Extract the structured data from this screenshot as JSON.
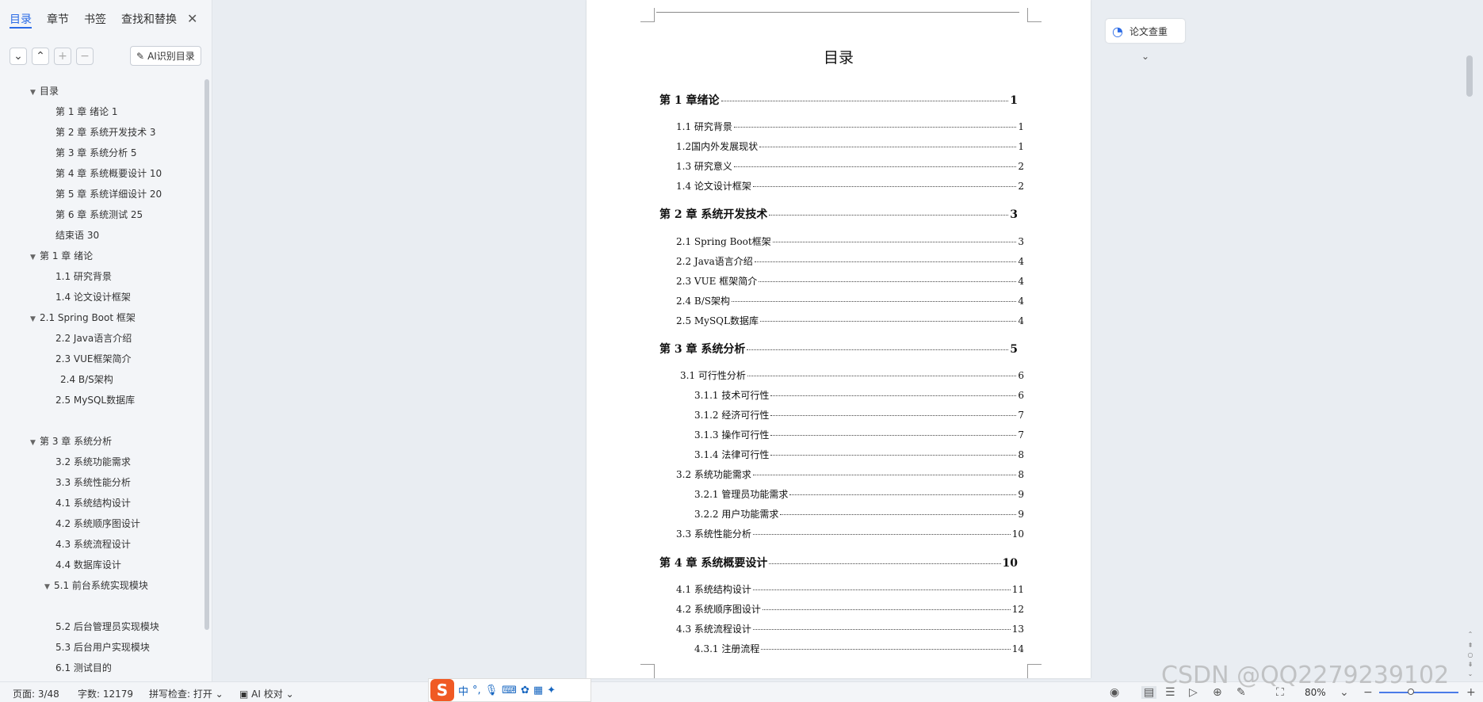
{
  "left_panel": {
    "tabs": [
      "目录",
      "章节",
      "书签",
      "查找和替换"
    ],
    "ai_button": "AI识别目录",
    "tree": [
      {
        "text": "目录",
        "level": 0,
        "expanded": true
      },
      {
        "text": "第 1 章  绪论 1",
        "level": 1
      },
      {
        "text": "第 2 章  系统开发技术 3",
        "level": 1
      },
      {
        "text": "第 3 章  系统分析 5",
        "level": 1
      },
      {
        "text": "第 4 章  系统概要设计 10",
        "level": 1
      },
      {
        "text": "第 5 章  系统详细设计 20",
        "level": 1
      },
      {
        "text": "第 6 章  系统测试 25",
        "level": 1
      },
      {
        "text": "结束语 30",
        "level": 1
      },
      {
        "text": "第 1 章  绪论",
        "level": 0,
        "expanded": true
      },
      {
        "text": "1.1  研究背景",
        "level": 1
      },
      {
        "text": "1.4  论文设计框架",
        "level": 1
      },
      {
        "text": "2.1 Spring Boot 框架",
        "level": 0,
        "expanded": true
      },
      {
        "text": "2.2 Java语言介绍",
        "level": 1
      },
      {
        "text": "2.3 VUE框架简介",
        "level": 1
      },
      {
        "text": "2.4    B/S架构",
        "level": 1
      },
      {
        "text": "2.5 MySQL数据库",
        "level": 1
      },
      {
        "text": "",
        "level": 1
      },
      {
        "text": "第 3 章  系统分析",
        "level": 0,
        "expanded": true
      },
      {
        "text": "3.2  系统功能需求",
        "level": 1
      },
      {
        "text": "3.3  系统性能分析",
        "level": 1
      },
      {
        "text": "4.1  系统结构设计",
        "level": 1
      },
      {
        "text": "4.2  系统顺序图设计",
        "level": 1
      },
      {
        "text": "4.3  系统流程设计",
        "level": 1
      },
      {
        "text": "4.4  数据库设计",
        "level": 1
      },
      {
        "text": "5.1  前台系统实现模块",
        "level": 1,
        "expanded": true
      },
      {
        "text": "",
        "level": 1
      },
      {
        "text": "5.2  后台管理员实现模块",
        "level": 1
      },
      {
        "text": "5.3  后台用户实现模块",
        "level": 1
      },
      {
        "text": "6.1  测试目的",
        "level": 1
      }
    ]
  },
  "document": {
    "title": "目录",
    "entries": [
      {
        "label": "第 1  章绪论",
        "page": "1",
        "kind": "chap"
      },
      {
        "label": "1.1  研究背景",
        "page": "1",
        "kind": "sec"
      },
      {
        "label": "1.2国内外发展现状",
        "page": "1",
        "kind": "sec"
      },
      {
        "label": "1.3  研究意义",
        "page": "2",
        "kind": "sec"
      },
      {
        "label": "1.4  论文设计框架",
        "page": "2",
        "kind": "sec"
      },
      {
        "label": "第 2  章  系统开发技术",
        "page": "3",
        "kind": "chap"
      },
      {
        "label": "2.1 Spring Boot框架",
        "page": "3",
        "kind": "sec"
      },
      {
        "label": "2.2 Java语言介绍",
        "page": "4",
        "kind": "sec"
      },
      {
        "label": "2.3 VUE 框架简介",
        "page": "4",
        "kind": "sec"
      },
      {
        "label": "2.4 B/S架构",
        "page": "4",
        "kind": "sec"
      },
      {
        "label": "2.5 MySQL数据库",
        "page": "4",
        "kind": "sec"
      },
      {
        "label": "第 3  章  系统分析",
        "page": "5",
        "kind": "chap"
      },
      {
        "label": "3.1  可行性分析",
        "page": "6",
        "kind": "sec"
      },
      {
        "label": "3.1.1  技术可行性",
        "page": "6",
        "kind": "sub"
      },
      {
        "label": "3.1.2  经济可行性",
        "page": "7",
        "kind": "sub"
      },
      {
        "label": "3.1.3  操作可行性",
        "page": "7",
        "kind": "sub"
      },
      {
        "label": "3.1.4  法律可行性",
        "page": "8",
        "kind": "sub"
      },
      {
        "label": "3.2  系统功能需求",
        "page": "8",
        "kind": "sec"
      },
      {
        "label": "3.2.1  管理员功能需求",
        "page": "9",
        "kind": "sub"
      },
      {
        "label": "3.2.2  用户功能需求",
        "page": "9",
        "kind": "sub"
      },
      {
        "label": "3.3  系统性能分析",
        "page": "10",
        "kind": "sec"
      },
      {
        "label": "第 4  章  系统概要设计",
        "page": "10",
        "kind": "chap"
      },
      {
        "label": "4.1  系统结构设计",
        "page": "11",
        "kind": "sec"
      },
      {
        "label": "4.2  系统顺序图设计",
        "page": "12",
        "kind": "sec"
      },
      {
        "label": "4.3  系统流程设计",
        "page": "13",
        "kind": "sec"
      },
      {
        "label": "4.3.1  注册流程",
        "page": "14",
        "kind": "sub"
      }
    ]
  },
  "right_panel": {
    "check_button": "论文查重"
  },
  "status": {
    "page": "页面: 3/48",
    "words": "字数: 12179",
    "spell": "拼写检查: 打开",
    "ai_proof": "AI 校对",
    "zoom": "80%",
    "ime_label": "中",
    "watermark": "CSDN @QQ2279239102"
  },
  "icons": {
    "collapse": "chevron-down-icon",
    "expand": "chevron-up-icon",
    "add": "plus-icon",
    "remove": "minus-icon",
    "check": "plagiarism-check-icon",
    "eye": "eye-icon"
  }
}
